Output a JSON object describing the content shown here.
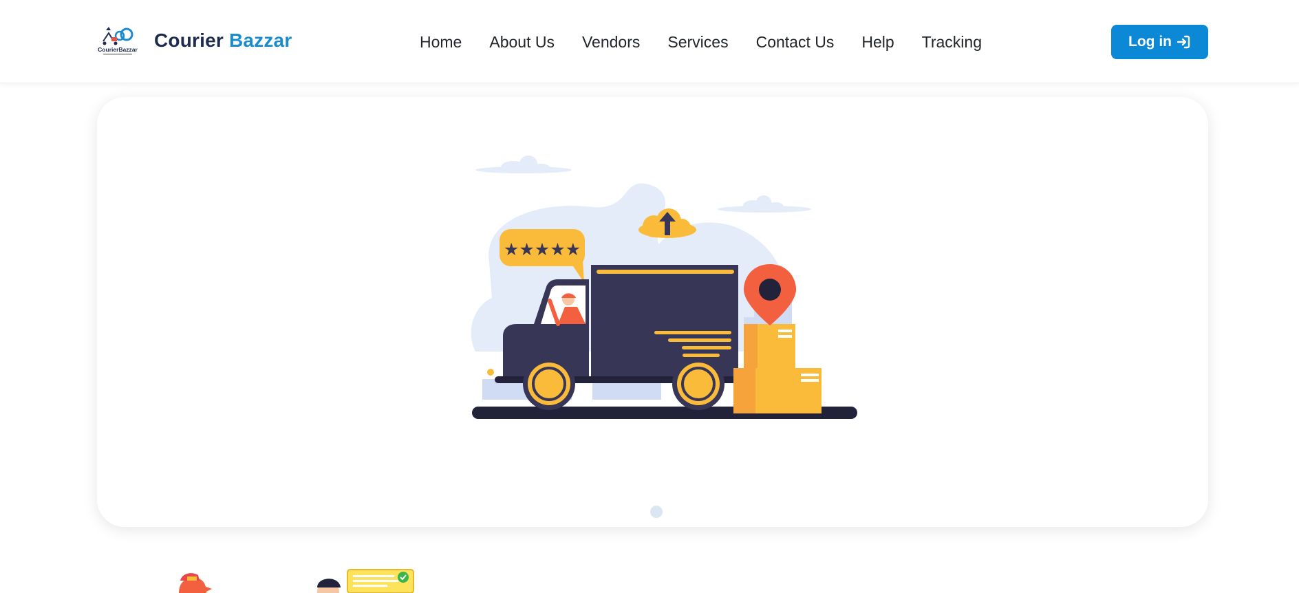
{
  "brand": {
    "name_part1": "Courier",
    "name_part2": "Bazzar",
    "logo_text": "CourierBazzar"
  },
  "nav": {
    "items": [
      {
        "label": "Home"
      },
      {
        "label": "About Us"
      },
      {
        "label": "Vendors"
      },
      {
        "label": "Services"
      },
      {
        "label": "Contact Us"
      },
      {
        "label": "Help"
      },
      {
        "label": "Tracking"
      }
    ]
  },
  "login": {
    "label": "Log in",
    "icon": "login-arrow-icon"
  },
  "hero": {
    "rating_stars": "★★★★★",
    "illustration": "delivery-truck-illustration",
    "slides": 1,
    "active_slide": 1
  },
  "colors": {
    "accent": "#0b88d6",
    "brand_dark": "#1d2b4f",
    "brand_blue": "#1b8bd0",
    "truck": "#373656",
    "yellow": "#fbbb3a",
    "pin": "#f2603f"
  }
}
